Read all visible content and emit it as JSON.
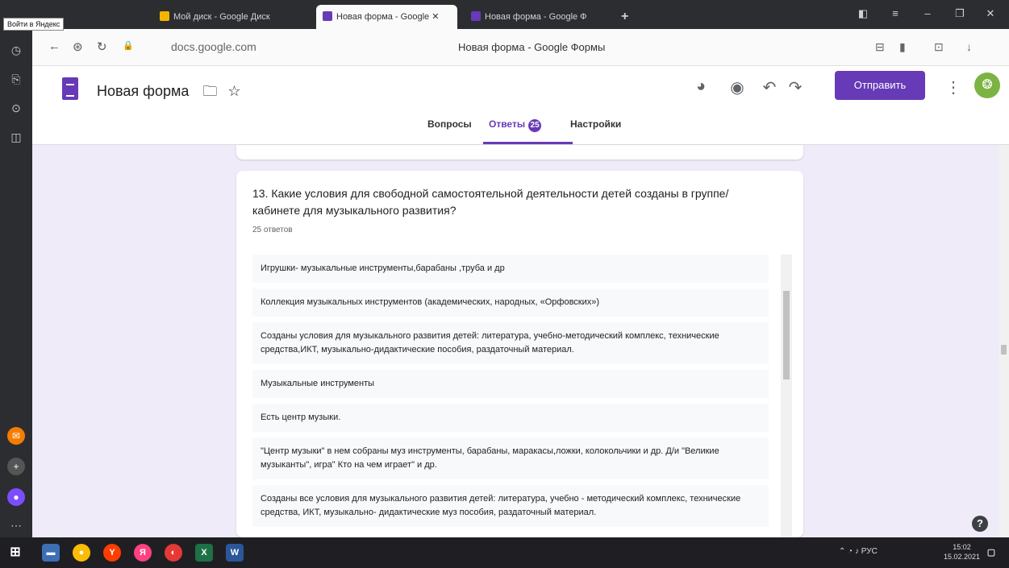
{
  "browser": {
    "tooltip": "Войти в Яндекс",
    "tabs": [
      {
        "label": "Мой диск - Google Диск"
      },
      {
        "label": "Новая форма - Google"
      },
      {
        "label": "Новая форма - Google Ф"
      }
    ],
    "new_tab": "+",
    "url": "docs.google.com",
    "page_title": "Новая форма - Google Формы"
  },
  "header": {
    "form_title": "Новая форма",
    "send_label": "Отправить",
    "tabs": {
      "questions": "Вопросы",
      "responses": "Ответы",
      "responses_count": "25",
      "settings": "Настройки"
    }
  },
  "question": {
    "title": "13. Какие условия    для   свободной   самостоятельной    деятельности детей созданы      в группе/кабинете  для музыкального развития?",
    "count": "25 ответов",
    "answers": [
      "Игрушки- музыкальные инструменты,барабаны ,труба и др",
      "Коллекция музыкальных инструментов (академических, народных, «Орфовских»)",
      "Созданы условия для музыкального развития детей: литература, учебно-методический комплекс, технические средства,ИКТ, музыкально-дидактические пособия, раздаточный материал.",
      "Музыкальные инструменты",
      "Есть центр музыки.",
      "\"Центр музыки\" в нем собраны муз инструменты, барабаны, маракасы,ложки, колокольчики и др. Д/и \"Великие музыканты\", игра\" Кто на чем играет\" и др.",
      "Созданы все условия для музыкального развития детей: литература, учебно - методический комплекс, технические средства, ИКТ, музыкально- дидактические муз пособия, раздаточный материал."
    ]
  },
  "taskbar": {
    "lang": "РУС",
    "time": "15:02",
    "date": "15.02.2021"
  },
  "colors": {
    "accent": "#673ab7",
    "background": "#f0ebf8"
  }
}
